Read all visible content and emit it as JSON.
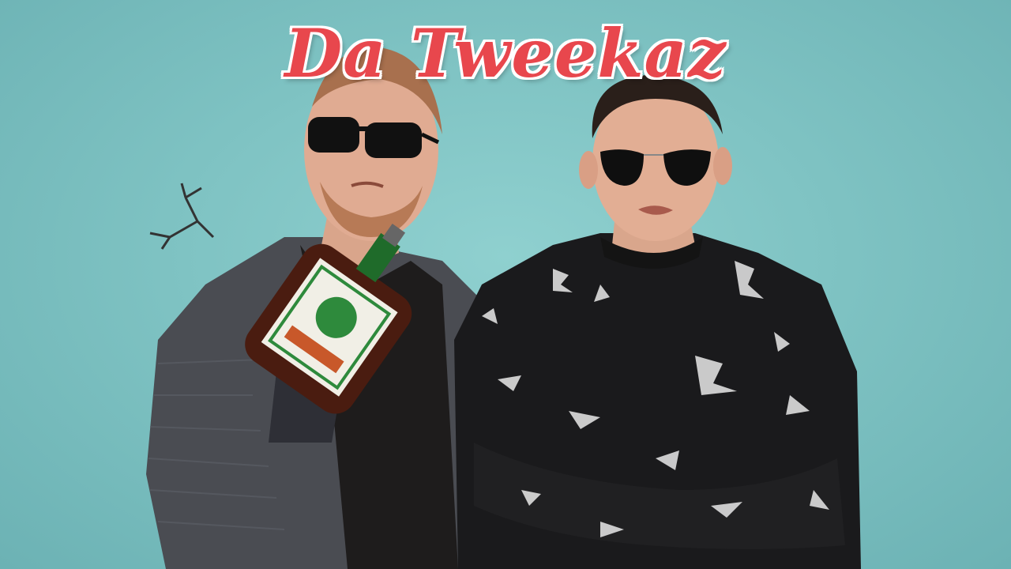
{
  "title": "Da Tweekaz",
  "colors": {
    "background": "#7fc3c3",
    "title_fill": "#e8474d",
    "title_outline": "#ffffff"
  },
  "photo": {
    "subjects": [
      "left-man-with-bottle",
      "right-man-arms-crossed"
    ]
  }
}
